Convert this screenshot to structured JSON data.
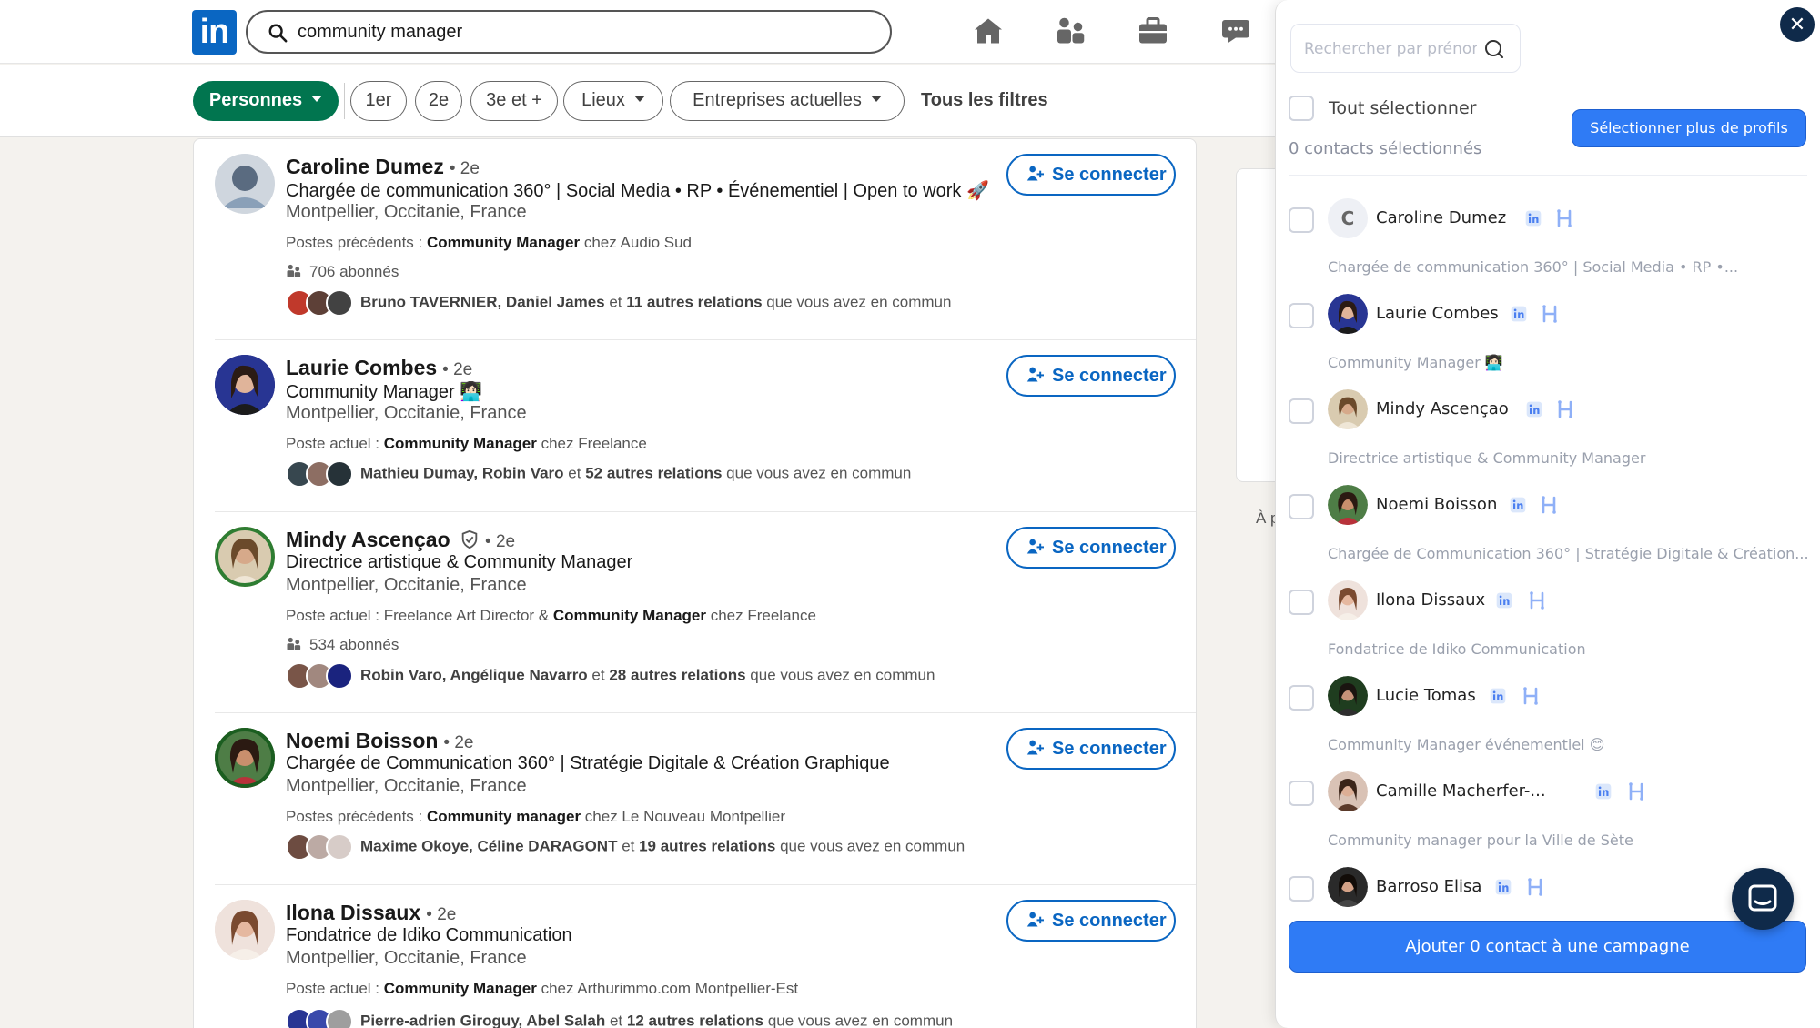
{
  "topbar": {
    "logo_text": "in",
    "search_value": "community manager",
    "nav": [
      "home-icon",
      "people-icon",
      "briefcase-icon",
      "messaging-icon"
    ]
  },
  "filters": {
    "active": "Personnes",
    "items": [
      "1er",
      "2e",
      "3e et +",
      "Lieux",
      "Entreprises actuelles"
    ],
    "all_filters": "Tous les filtres"
  },
  "results": [
    {
      "name": "Caroline Dumez",
      "degree": "• 2e",
      "headline": "Chargée de communication 360° | Social Media • RP • Événementiel | Open to work 🚀",
      "location": "Montpellier, Occitanie, France",
      "meta_prefix": "Postes précédents : ",
      "meta_bold": "Community Manager",
      "meta_suffix": " chez Audio Sud",
      "followers": "706 abonnés",
      "mutual_bold_1": "Bruno TAVERNIER, Daniel James",
      "mutual_mid": " et ",
      "mutual_bold_2": "11 autres relations",
      "mutual_end": " que vous avez en commun",
      "connect": "Se connecter"
    },
    {
      "name": "Laurie Combes",
      "degree": "• 2e",
      "headline": "Community Manager 👩🏻‍💻",
      "location": "Montpellier, Occitanie, France",
      "meta_prefix": "Poste actuel : ",
      "meta_bold": "Community Manager",
      "meta_suffix": " chez Freelance",
      "mutual_bold_1": "Mathieu Dumay, Robin Varo",
      "mutual_mid": " et ",
      "mutual_bold_2": "52 autres relations",
      "mutual_end": " que vous avez en commun",
      "connect": "Se connecter"
    },
    {
      "name": "Mindy Ascençao",
      "degree": "• 2e",
      "headline": "Directrice artistique & Community Manager",
      "location": "Montpellier, Occitanie, France",
      "meta_prefix": "Poste actuel : Freelance Art Director & ",
      "meta_bold": "Community Manager",
      "meta_suffix": " chez Freelance",
      "followers": "534 abonnés",
      "mutual_bold_1": "Robin Varo, Angélique Navarro",
      "mutual_mid": " et ",
      "mutual_bold_2": "28 autres relations",
      "mutual_end": " que vous avez en commun",
      "connect": "Se connecter"
    },
    {
      "name": "Noemi Boisson",
      "degree": "• 2e",
      "headline": "Chargée de Communication 360° | Stratégie Digitale & Création Graphique",
      "location": "Montpellier, Occitanie, France",
      "meta_prefix": "Postes précédents : ",
      "meta_bold": "Community manager",
      "meta_suffix": " chez Le Nouveau Montpellier",
      "mutual_bold_1": "Maxime Okoye, Céline DARAGONT",
      "mutual_mid": " et ",
      "mutual_bold_2": "19 autres relations",
      "mutual_end": " que vous avez en commun",
      "connect": "Se connecter"
    },
    {
      "name": "Ilona Dissaux",
      "degree": "• 2e",
      "headline": "Fondatrice de Idiko Communication",
      "location": "Montpellier, Occitanie, France",
      "meta_prefix": "Poste actuel : ",
      "meta_bold": "Community Manager",
      "meta_suffix": " chez Arthurimmo.com Montpellier-Est",
      "mutual_bold_1": "Pierre-adrien Giroguy, Abel Salah",
      "mutual_mid": " et ",
      "mutual_bold_2": "12 autres relations",
      "mutual_end": " que vous avez en commun",
      "connect": "Se connecter"
    }
  ],
  "ghost_text": "À p",
  "panel": {
    "search_placeholder": "Rechercher par prénom",
    "select_all": "Tout sélectionner",
    "count": "0 contacts sélectionnés",
    "more_button": "Sélectionner plus de profils",
    "close": "✕",
    "cta": "Ajouter 0 contact à une campagne",
    "contacts": [
      {
        "name": "Caroline Dumez",
        "sub": "Chargée de communication 360° | Social Media • RP •...",
        "initial": "C"
      },
      {
        "name": "Laurie Combes",
        "sub": "Community Manager 👩🏻‍💻"
      },
      {
        "name": "Mindy Ascençao",
        "sub": "Directrice artistique & Community Manager"
      },
      {
        "name": "Noemi Boisson",
        "sub": "Chargée de Communication 360° | Stratégie Digitale & Création..."
      },
      {
        "name": "Ilona Dissaux",
        "sub": "Fondatrice de Idiko Communication"
      },
      {
        "name": "Lucie Tomas",
        "sub": "Community Manager événementiel 😊"
      },
      {
        "name": "Camille Macher­fer-...",
        "sub": "Community manager pour la Ville de Sète"
      },
      {
        "name": "Barroso Elisa",
        "sub": ""
      }
    ]
  },
  "colors": {
    "linkedin_blue": "#0a66c2",
    "active_filter_green": "#01754f",
    "panel_button_blue": "#2f7bf5",
    "panel_dark": "#0f2a4a"
  }
}
